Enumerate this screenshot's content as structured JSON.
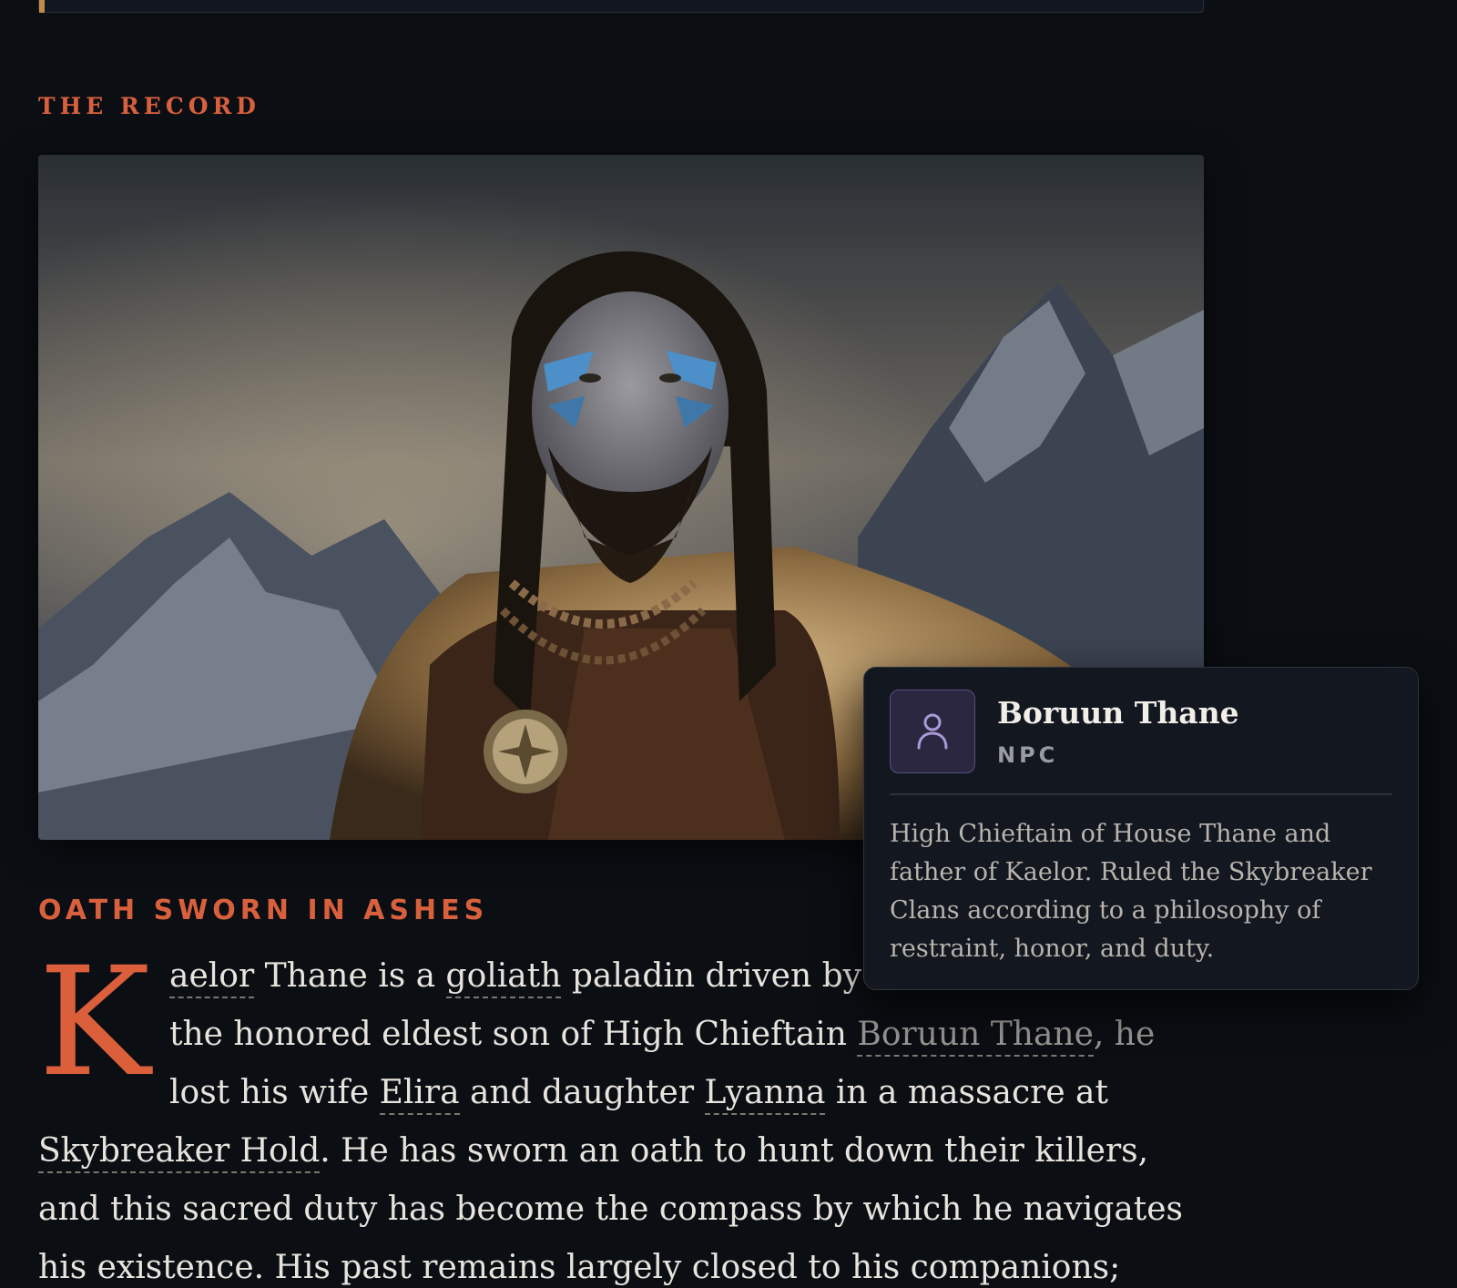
{
  "record": {
    "kicker": "THE RECORD"
  },
  "hero": {
    "alt": "Portrait of a goliath paladin with blue war paint and fur cloak before snowy mountains"
  },
  "story": {
    "section_title": "OATH SWORN IN ASHES",
    "drop_cap": "K",
    "line1": {
      "link1": "aelor",
      "text1": " Thane is a ",
      "link2": "goliath",
      "text2": " paladin driven by"
    },
    "line2": {
      "text1": "the honored eldest son of High Chieftain ",
      "link1": "Boruun Thane",
      "text2": ", he"
    },
    "line3": {
      "text1": "lost his wife ",
      "link1": "Elira",
      "text2": " and daughter ",
      "link2": "Lyanna",
      "text3": " in a massacre at"
    },
    "line4": {
      "link1": "Skybreaker Hold",
      "text1": ". He has sworn an oath to hunt down their killers,"
    },
    "line5": {
      "text1": "and this sacred duty has become the compass by which he navigates"
    },
    "line6": {
      "text1": "his existence. His past remains largely closed to his companions;"
    }
  },
  "popover": {
    "name": "Boruun Thane",
    "type": "NPC",
    "icon": "person-icon",
    "description": "High Chieftain of House Thane and father of Kaelor. Ruled the Skybreaker Clans according to a philosophy of restraint, honor, and duty."
  },
  "colors": {
    "accent": "#d9603d",
    "background": "#0b0e13",
    "popover_icon_bg": "#2c2741"
  }
}
